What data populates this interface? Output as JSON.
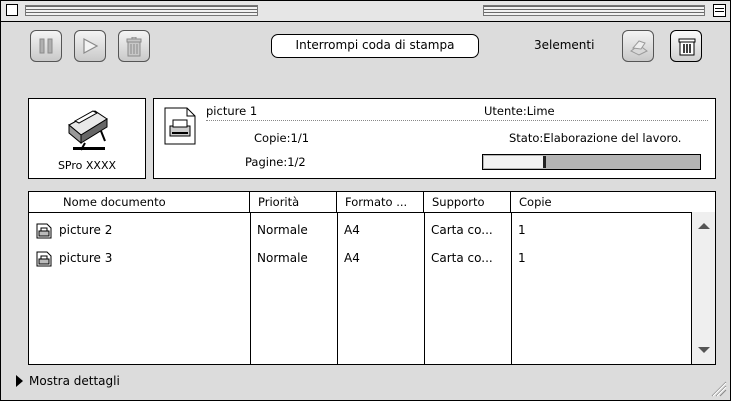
{
  "titlebar": {},
  "toolbar": {
    "pause_icon": "pause-icon",
    "resume_icon": "play-icon",
    "delete_icon": "trash-icon",
    "cancel_label": "Interrompi coda di stampa",
    "count_label": "3elementi"
  },
  "printer": {
    "name": "SPro XXXX"
  },
  "current_job": {
    "title": "picture 1",
    "user": "Utente:Lime",
    "copies": "Copie:1/1",
    "status": "Stato:Elaborazione del lavoro.",
    "pages": "Pagine:1/2",
    "progress": 0.27
  },
  "queue": {
    "columns": [
      "Nome documento",
      "Priorità",
      "Formato ...",
      "Supporto",
      "Copie"
    ],
    "rows": [
      {
        "name": "picture  2",
        "priority": "Normale",
        "format": "A4",
        "media": "Carta co...",
        "copies": "1"
      },
      {
        "name": "picture  3",
        "priority": "Normale",
        "format": "A4",
        "media": "Carta co...",
        "copies": "1"
      }
    ]
  },
  "footer": {
    "details_label": "Mostra dettagli"
  }
}
